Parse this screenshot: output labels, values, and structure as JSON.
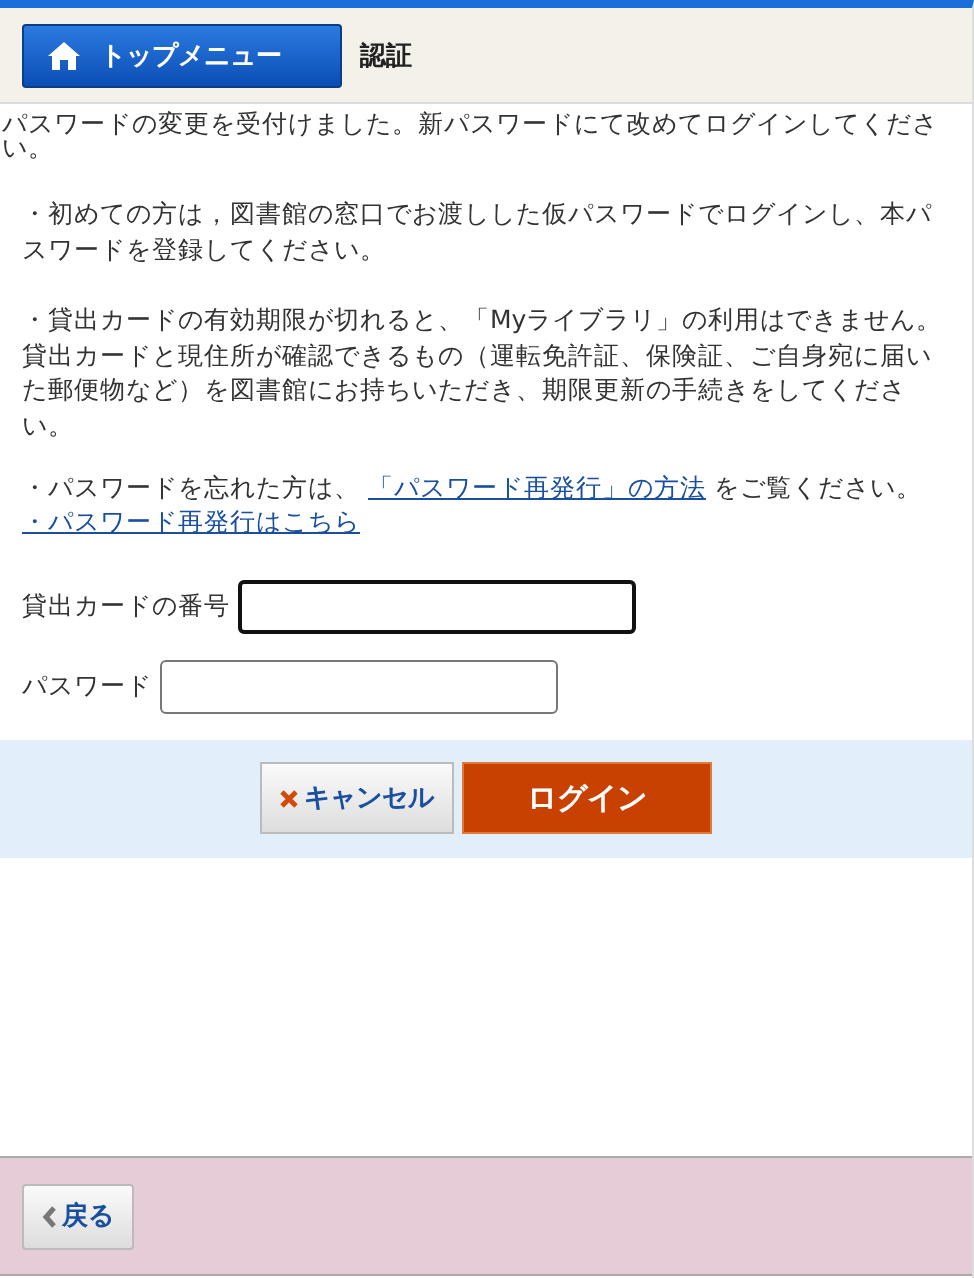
{
  "header": {
    "home_button": "トップメニュー",
    "title": "認証"
  },
  "notice": "パスワードの変更を受付けました。新パスワードにて改めてログインしてください。",
  "paragraphs": [
    {
      "text": "・初めての方は，図書館の窓口でお渡しした仮パスワードでログインし、本パスワードを登録してください。"
    },
    {
      "text": "・貸出カードの有効期限が切れると、「Myライブラリ」の利用はできません。貸出カードと現住所が確認できるもの（運転免許証、保険証、ご自身宛に届いた郵便物など）を図書館にお持ちいただき、期限更新の手続きをしてください。"
    }
  ],
  "forgot": {
    "before": "・パスワードを忘れた方は、",
    "link": "「パスワード再発行」の方法",
    "after": "をご覧ください。"
  },
  "reissue_link": "・パスワード再発行はこちら",
  "fields": [
    {
      "label": "貸出カードの番号",
      "focused": true
    },
    {
      "label": "パスワード",
      "focused": false
    }
  ],
  "buttons": {
    "cancel": "キャンセル",
    "login": "ログイン"
  },
  "footer": {
    "back": "戻る"
  }
}
